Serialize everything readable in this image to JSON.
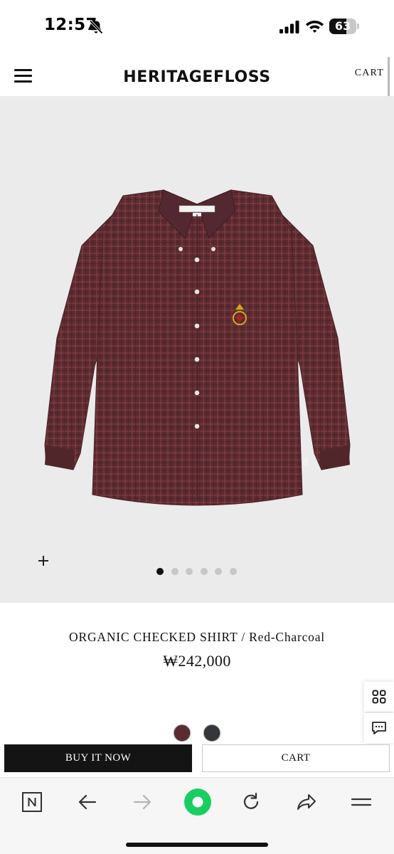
{
  "status_bar": {
    "time": "12:57",
    "battery_percent": "63",
    "battery_level": 0.63,
    "icons": [
      "bell-slash-icon",
      "signal-bars-icon",
      "wifi-icon",
      "battery-icon"
    ]
  },
  "header": {
    "brand": "HERITAGEFLOSS",
    "cart_label": "CART",
    "menu_icon": "hamburger-menu-icon"
  },
  "gallery": {
    "image_subject": "red-charcoal checked shirt",
    "image_count": 6,
    "active_index": 0,
    "zoom_icon": "plus-icon",
    "background": "#ebebeb"
  },
  "product": {
    "title": "ORGANIC CHECKED SHIRT / Red-Charcoal",
    "price": "₩242,000",
    "swatches": [
      {
        "name": "Red-Charcoal",
        "color": "#5a2b30"
      },
      {
        "name": "Charcoal",
        "color": "#34363a"
      }
    ]
  },
  "side_buttons": [
    "grid-icon",
    "chat-icon"
  ],
  "actions": {
    "buy_now_label": "BUY IT NOW",
    "cart_label": "CART"
  },
  "browser_toolbar": {
    "items": [
      "naver-n-icon",
      "back-arrow-icon",
      "forward-arrow-icon",
      "green-circle-icon",
      "reload-icon",
      "share-icon",
      "menu-lines-icon"
    ],
    "accent_color": "#19ce60"
  }
}
